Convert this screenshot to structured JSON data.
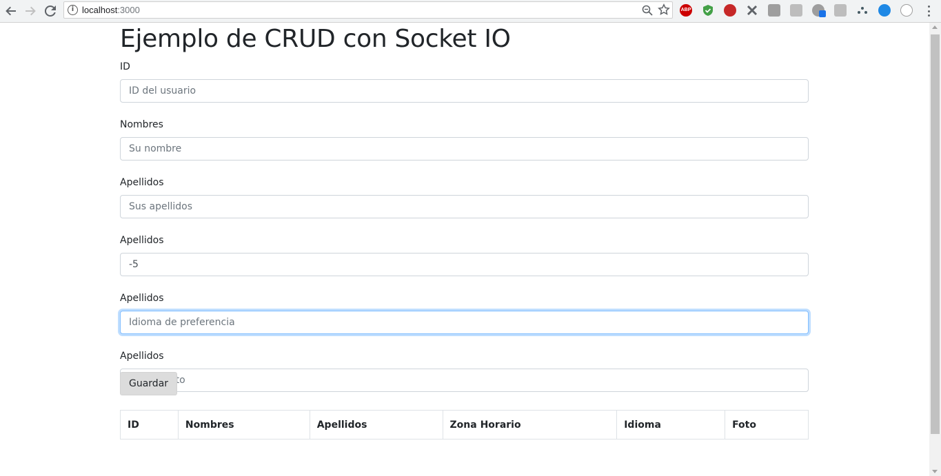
{
  "browser": {
    "url_host": "localhost",
    "url_port": ":3000",
    "extensions": [
      "abp",
      "shield",
      "stop",
      "puzzle",
      "bag",
      "pdf",
      "ghost",
      "cube",
      "dots",
      "globe",
      "circle"
    ],
    "abp_label": "ABP"
  },
  "page": {
    "title": "Ejemplo de CRUD con Socket IO"
  },
  "form": {
    "fields": [
      {
        "label": "ID",
        "value": "",
        "placeholder": "ID del usuario"
      },
      {
        "label": "Nombres",
        "value": "",
        "placeholder": "Su nombre"
      },
      {
        "label": "Apellidos",
        "value": "",
        "placeholder": "Sus apellidos"
      },
      {
        "label": "Apellidos",
        "value": "-5",
        "placeholder": ""
      },
      {
        "label": "Apellidos",
        "value": "",
        "placeholder": "Idioma de preferencia"
      },
      {
        "label": "Apellidos",
        "value": "",
        "placeholder": "URL de foto"
      }
    ],
    "submit_label": "Guardar"
  },
  "table": {
    "headers": [
      "ID",
      "Nombres",
      "Apellidos",
      "Zona Horario",
      "Idioma",
      "Foto"
    ]
  },
  "colors": {
    "focus_border": "#80bdff",
    "button_bg": "#dcdcdc"
  }
}
